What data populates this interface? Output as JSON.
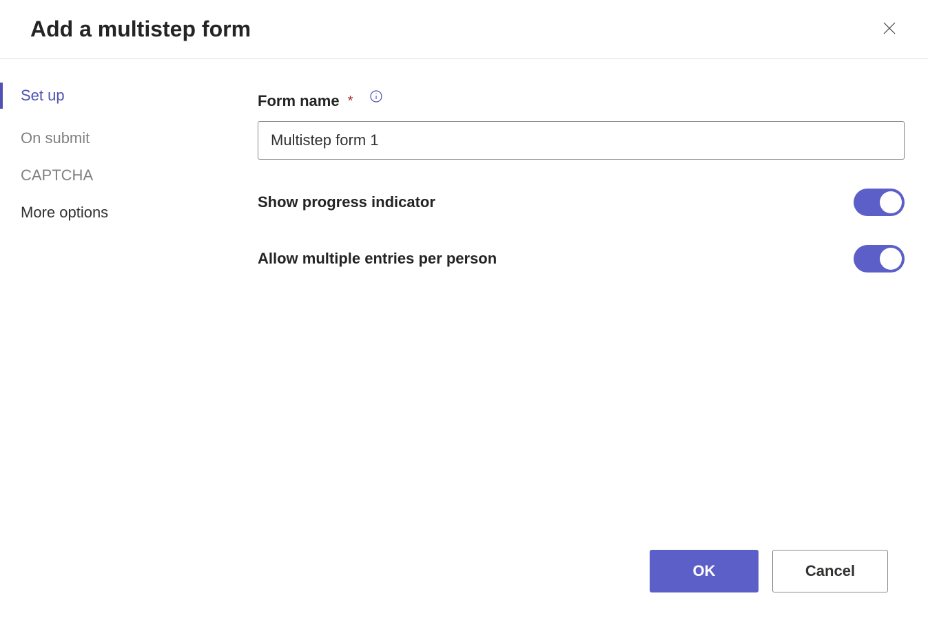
{
  "header": {
    "title": "Add a multistep form"
  },
  "sidebar": {
    "items": [
      {
        "label": "Set up",
        "active": true
      },
      {
        "label": "On submit",
        "active": false
      },
      {
        "label": "CAPTCHA",
        "active": false
      },
      {
        "label": "More options",
        "active": false
      }
    ]
  },
  "main": {
    "form_name_label": "Form name",
    "form_name_value": "Multistep form 1",
    "show_progress_label": "Show progress indicator",
    "show_progress_on": true,
    "allow_multiple_label": "Allow multiple entries per person",
    "allow_multiple_on": true
  },
  "footer": {
    "ok_label": "OK",
    "cancel_label": "Cancel"
  }
}
